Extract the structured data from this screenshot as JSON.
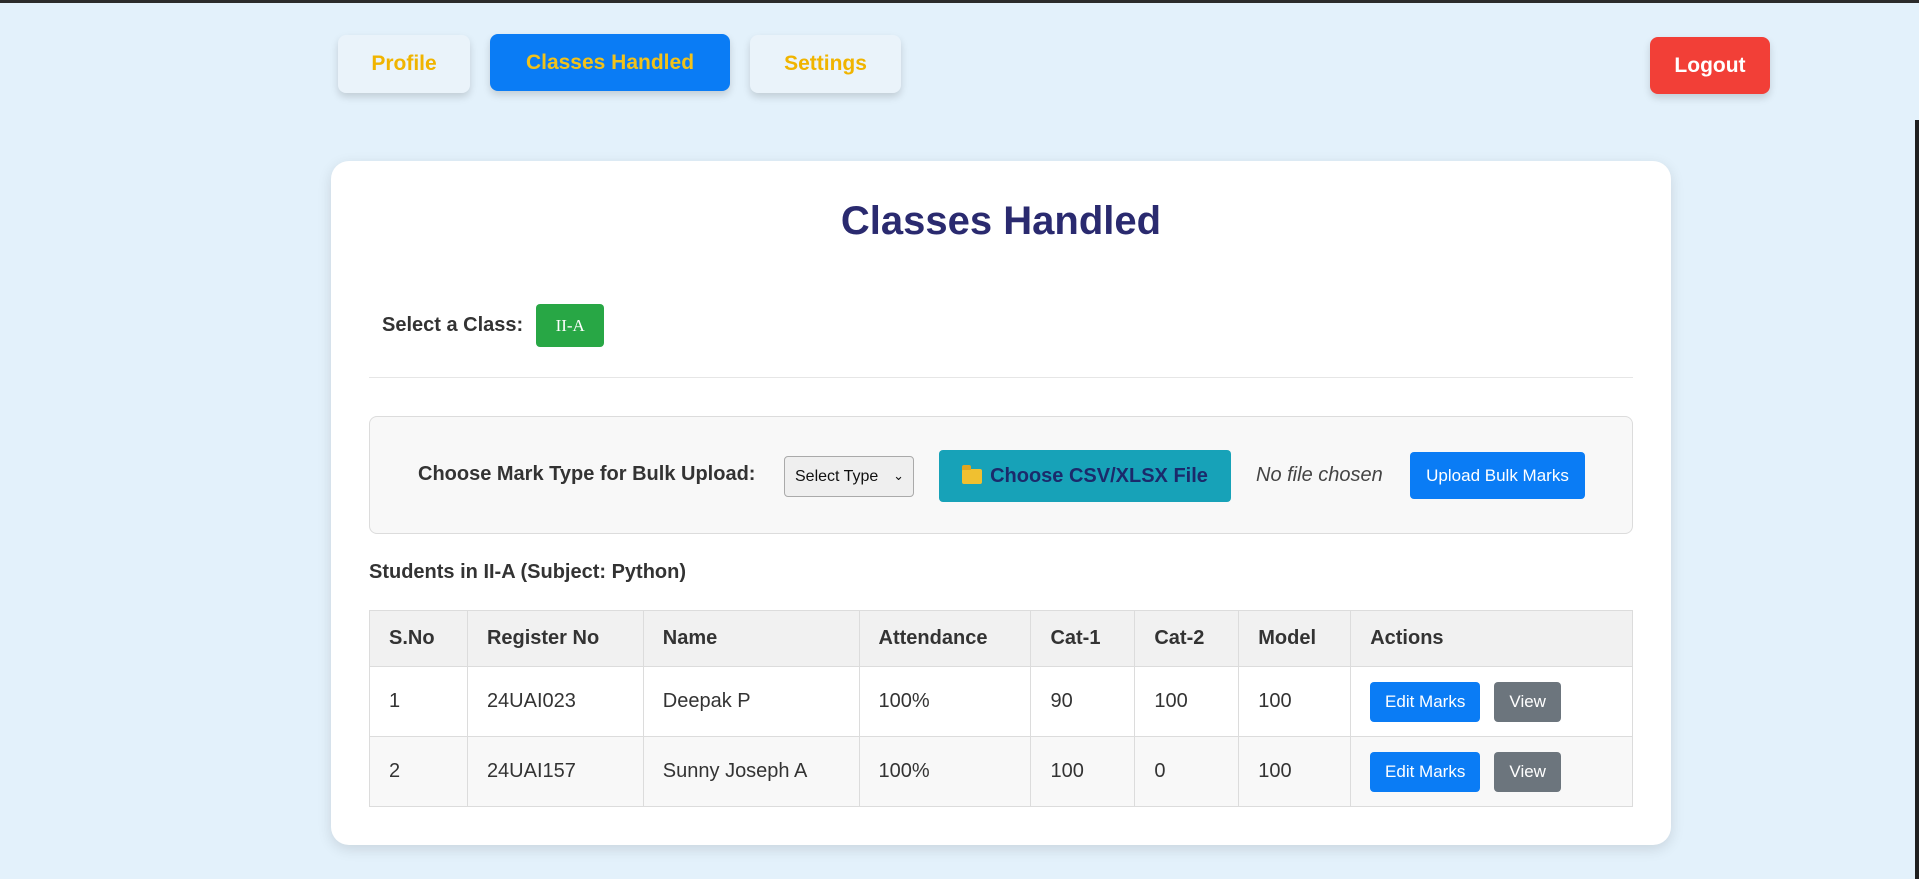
{
  "nav": {
    "profile": "Profile",
    "classes_handled": "Classes Handled",
    "settings": "Settings",
    "logout": "Logout"
  },
  "card": {
    "title": "Classes Handled",
    "select_label": "Select a Class:",
    "selected_class": "II-A"
  },
  "upload": {
    "label": "Choose Mark Type for Bulk Upload:",
    "select_value": "Select Type",
    "choose_file": "Choose CSV/XLSX File",
    "file_status": "No file chosen",
    "upload_button": "Upload Bulk Marks"
  },
  "students": {
    "title": "Students in II-A (Subject: Python)",
    "headers": [
      "S.No",
      "Register No",
      "Name",
      "Attendance",
      "Cat-1",
      "Cat-2",
      "Model",
      "Actions"
    ],
    "rows": [
      {
        "sno": "1",
        "regno": "24UAI023",
        "name": "Deepak P",
        "attendance": "100%",
        "cat1": "90",
        "cat2": "100",
        "model": "100"
      },
      {
        "sno": "2",
        "regno": "24UAI157",
        "name": "Sunny Joseph A",
        "attendance": "100%",
        "cat1": "100",
        "cat2": "0",
        "model": "100"
      }
    ],
    "edit_label": "Edit Marks",
    "view_label": "View"
  },
  "colors": {
    "accent": "#0a7cf5",
    "nav_text": "#f0b400",
    "logout": "#f23f37",
    "class_badge": "#28a745",
    "file_button": "#17a2b8",
    "title": "#2a2a6f"
  }
}
